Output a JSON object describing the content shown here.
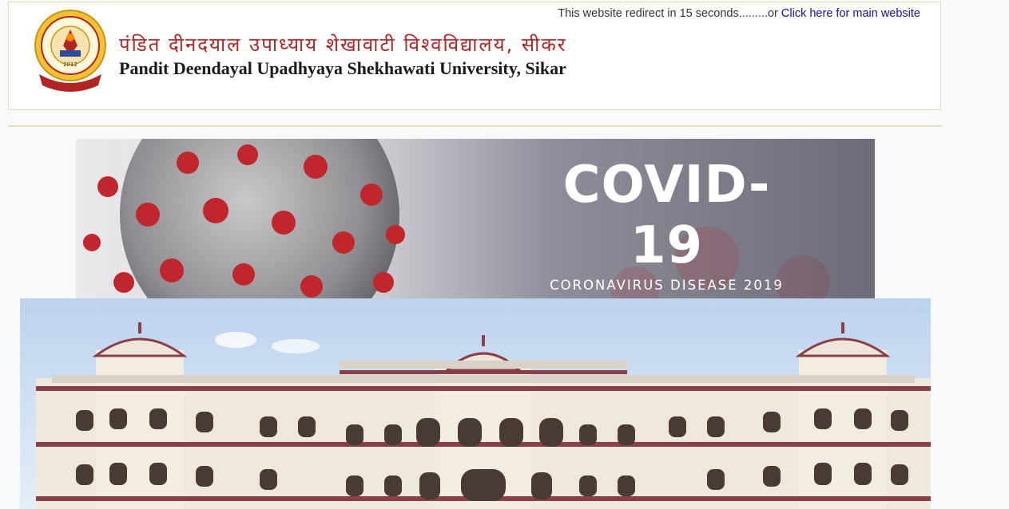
{
  "header": {
    "redirect_text": "This website redirect in 15 seconds.........or",
    "redirect_link": "Click here for main website",
    "title_hindi": "पंडित दीनदयाल उपाध्याय शेखावाटी विश्वविद्यालय, सीकर",
    "title_english": "Pandit Deendayal Upadhyaya Shekhawati University, Sikar",
    "logo_year": "2012"
  },
  "banner": {
    "title": "COVID-19",
    "subtitle": "CORONAVIRUS DISEASE 2019"
  },
  "colors": {
    "hindi_title": "#b32424",
    "link": "#1a0dab",
    "border": "#e3dcb6"
  }
}
